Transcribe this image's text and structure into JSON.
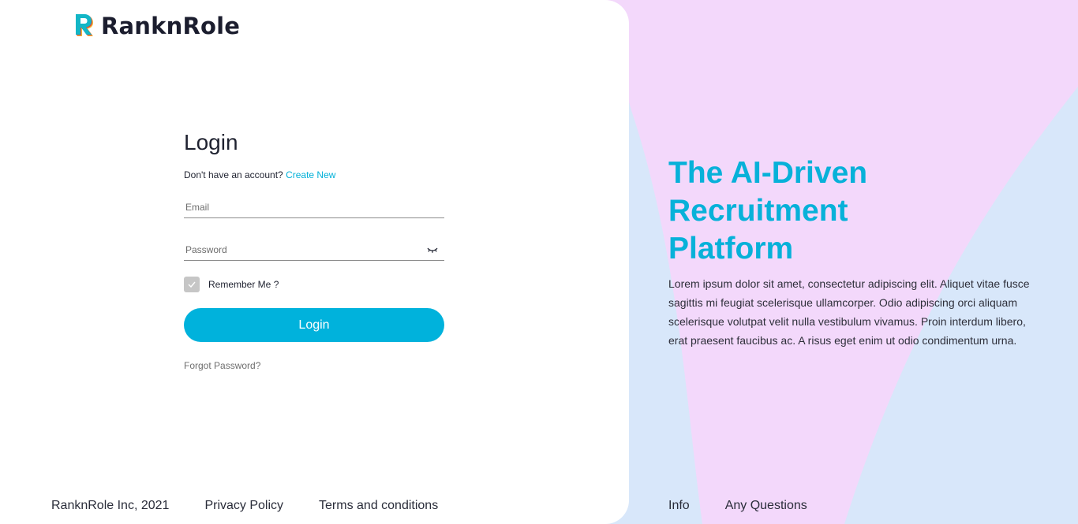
{
  "brand": {
    "name": "RanknRole"
  },
  "login": {
    "title": "Login",
    "signup_prompt": "Don't have an account?",
    "signup_link": "Create New",
    "email_placeholder": "Email",
    "password_placeholder": "Password",
    "remember_label": "Remember Me ?",
    "remember_checked": true,
    "submit_label": "Login",
    "forgot_label": "Forgot Password?"
  },
  "footer_left": {
    "copyright": "RanknRole Inc, 2021",
    "privacy": "Privacy Policy",
    "terms": "Terms and conditions"
  },
  "hero": {
    "title": "The AI-Driven Recruitment Platform",
    "description": "Lorem ipsum dolor sit amet, consectetur adipiscing elit. Aliquet vitae fusce sagittis mi feugiat scelerisque ullamcorper. Odio adipiscing orci aliquam scelerisque volutpat velit nulla vestibulum vivamus. Proin interdum libero, erat praesent faucibus ac. A risus eget enim ut odio condimentum urna."
  },
  "footer_right": {
    "info": "Info",
    "questions": "Any Questions"
  },
  "colors": {
    "accent": "#00b2dc",
    "pink_panel": "#f3d8fb",
    "blue_panel": "#d8e7fa",
    "checkbox_bg": "#c6c6c6"
  },
  "icons": {
    "eye": "eye-closed-icon",
    "check": "check-icon",
    "logo": "rankn-logo-icon"
  }
}
